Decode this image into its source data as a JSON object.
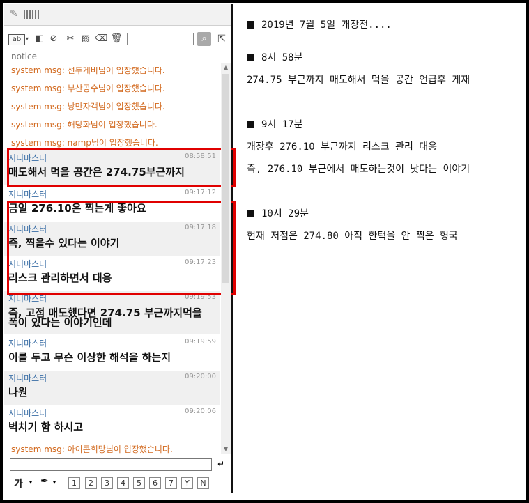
{
  "chat": {
    "toolbar": {
      "font_style_label": "ab",
      "search_placeholder": ""
    },
    "notice_label": "notice",
    "messages": [
      {
        "type": "system",
        "text": "system msg: 선두게비님이 입장했습니다."
      },
      {
        "type": "system",
        "text": "system msg: 부산공수님이 입장했습니다."
      },
      {
        "type": "system",
        "text": "system msg: 낭만자객님이 입장했습니다."
      },
      {
        "type": "system",
        "text": "system msg: 해당화님이 입장했습니다."
      },
      {
        "type": "system",
        "text": "system msg: namp님이 입장했습니다."
      },
      {
        "type": "chat",
        "nick": "지니마스터",
        "time": "08:58:51",
        "text": "매도해서 먹을 공간은 274.75부근까지"
      },
      {
        "type": "chat",
        "nick": "지니마스터",
        "time": "09:17:12",
        "text": "금일 276.10은 찍는게 좋아요"
      },
      {
        "type": "chat",
        "nick": "지니마스터",
        "time": "09:17:18",
        "text": "즉, 찍을수 있다는 이야기"
      },
      {
        "type": "chat",
        "nick": "지니마스터",
        "time": "09:17:23",
        "text": "리스크 관리하면서 대응"
      },
      {
        "type": "chat",
        "nick": "지니마스터",
        "time": "09:19:53",
        "text": "즉, 고점 매도했다면 274.75 부근까지먹을 폭이 있다는 이야기인데"
      },
      {
        "type": "chat",
        "nick": "지니마스터",
        "time": "09:19:59",
        "text": "이를 두고 무슨 이상한 해석을 하는지"
      },
      {
        "type": "chat",
        "nick": "지니마스터",
        "time": "09:20:00",
        "text": "나원"
      },
      {
        "type": "chat",
        "nick": "지니마스터",
        "time": "09:20:06",
        "text": "벽치기 함 하시고"
      },
      {
        "type": "system",
        "text": "system msg: 아이콘희망님이 입장했습니다."
      }
    ],
    "input_value": "",
    "bottom": {
      "font_label": "가",
      "emoticons": [
        "1",
        "2",
        "3",
        "4",
        "5",
        "6",
        "7",
        "Y",
        "N"
      ]
    }
  },
  "notes": [
    {
      "bullet": true,
      "text": "2019년 7월 5일 개장전...."
    },
    {
      "bullet": true,
      "text": "8시 58분"
    },
    {
      "bullet": false,
      "text": "274.75 부근까지 매도해서 먹을 공간 언급후 게재"
    },
    {
      "bullet": true,
      "text": "9시 17분"
    },
    {
      "bullet": false,
      "text": "개장후 276.10 부근까지 리스크 관리 대응"
    },
    {
      "bullet": false,
      "text": "즉, 276.10 부근에서 매도하는것이 낫다는 이야기"
    },
    {
      "bullet": true,
      "text": "10시 29분"
    },
    {
      "bullet": false,
      "text": "현재 저점은 274.80 아직 한턱을 안 찍은 형국"
    }
  ],
  "colors": {
    "system_msg": "#d2691e",
    "nick": "#3a6ea5",
    "highlight_box": "#e00000"
  }
}
